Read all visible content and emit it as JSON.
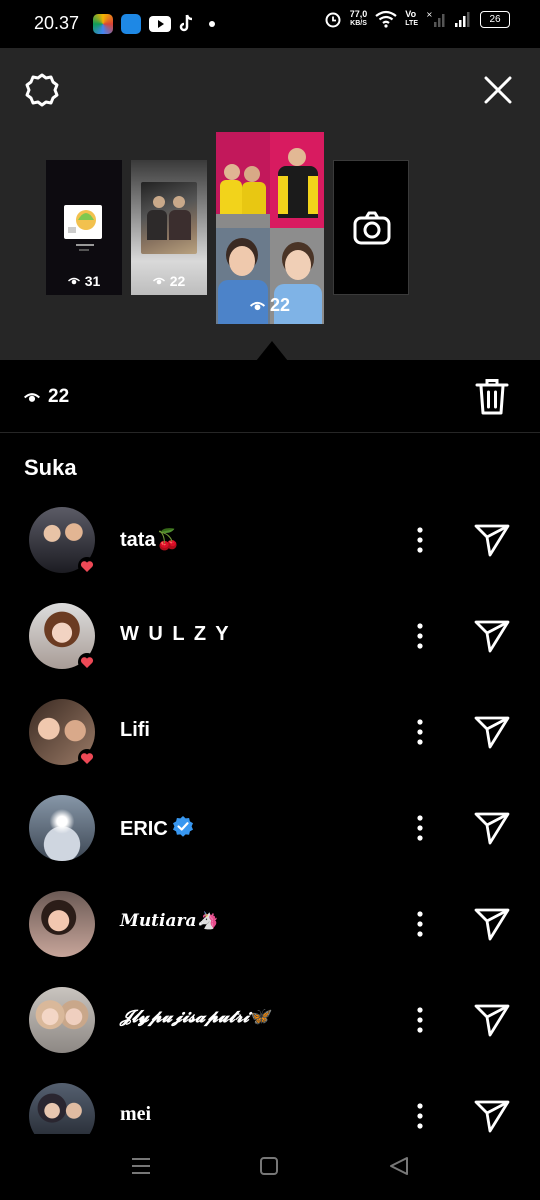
{
  "status_bar": {
    "time": "20.37",
    "net_speed_value": "77,0",
    "net_speed_unit": "KB/S",
    "lte_line1": "Vo",
    "lte_line2": "LTE",
    "battery": "26"
  },
  "story_thumbs": [
    {
      "views": "31"
    },
    {
      "views": "22"
    },
    {
      "views": "22"
    }
  ],
  "viewer_summary": {
    "count": "22"
  },
  "likes_section": {
    "title": "Suka"
  },
  "viewers": [
    {
      "name": "tata🍒",
      "liked": true,
      "verified": false,
      "style": "normal"
    },
    {
      "name": "W U L Z Y",
      "liked": true,
      "verified": false,
      "style": "spaced"
    },
    {
      "name": "Lifi",
      "liked": true,
      "verified": false,
      "style": "normal"
    },
    {
      "name": "ERIC",
      "liked": false,
      "verified": true,
      "style": "normal"
    },
    {
      "name": "𝑴𝒖𝒕𝒊𝒂𝒓𝒂🦄",
      "liked": false,
      "verified": false,
      "style": "script"
    },
    {
      "name": "𝓙𝓵𝔂𝓹𝓾𝓳𝓲𝓼𝓪𝓹𝓾𝓽𝓻𝓲🦋",
      "liked": false,
      "verified": false,
      "style": "script"
    },
    {
      "name": "mei",
      "liked": false,
      "verified": false,
      "style": "serif"
    }
  ],
  "colors": {
    "heart": "#ed4956",
    "verified": "#3897f0",
    "panel": "#262626"
  }
}
